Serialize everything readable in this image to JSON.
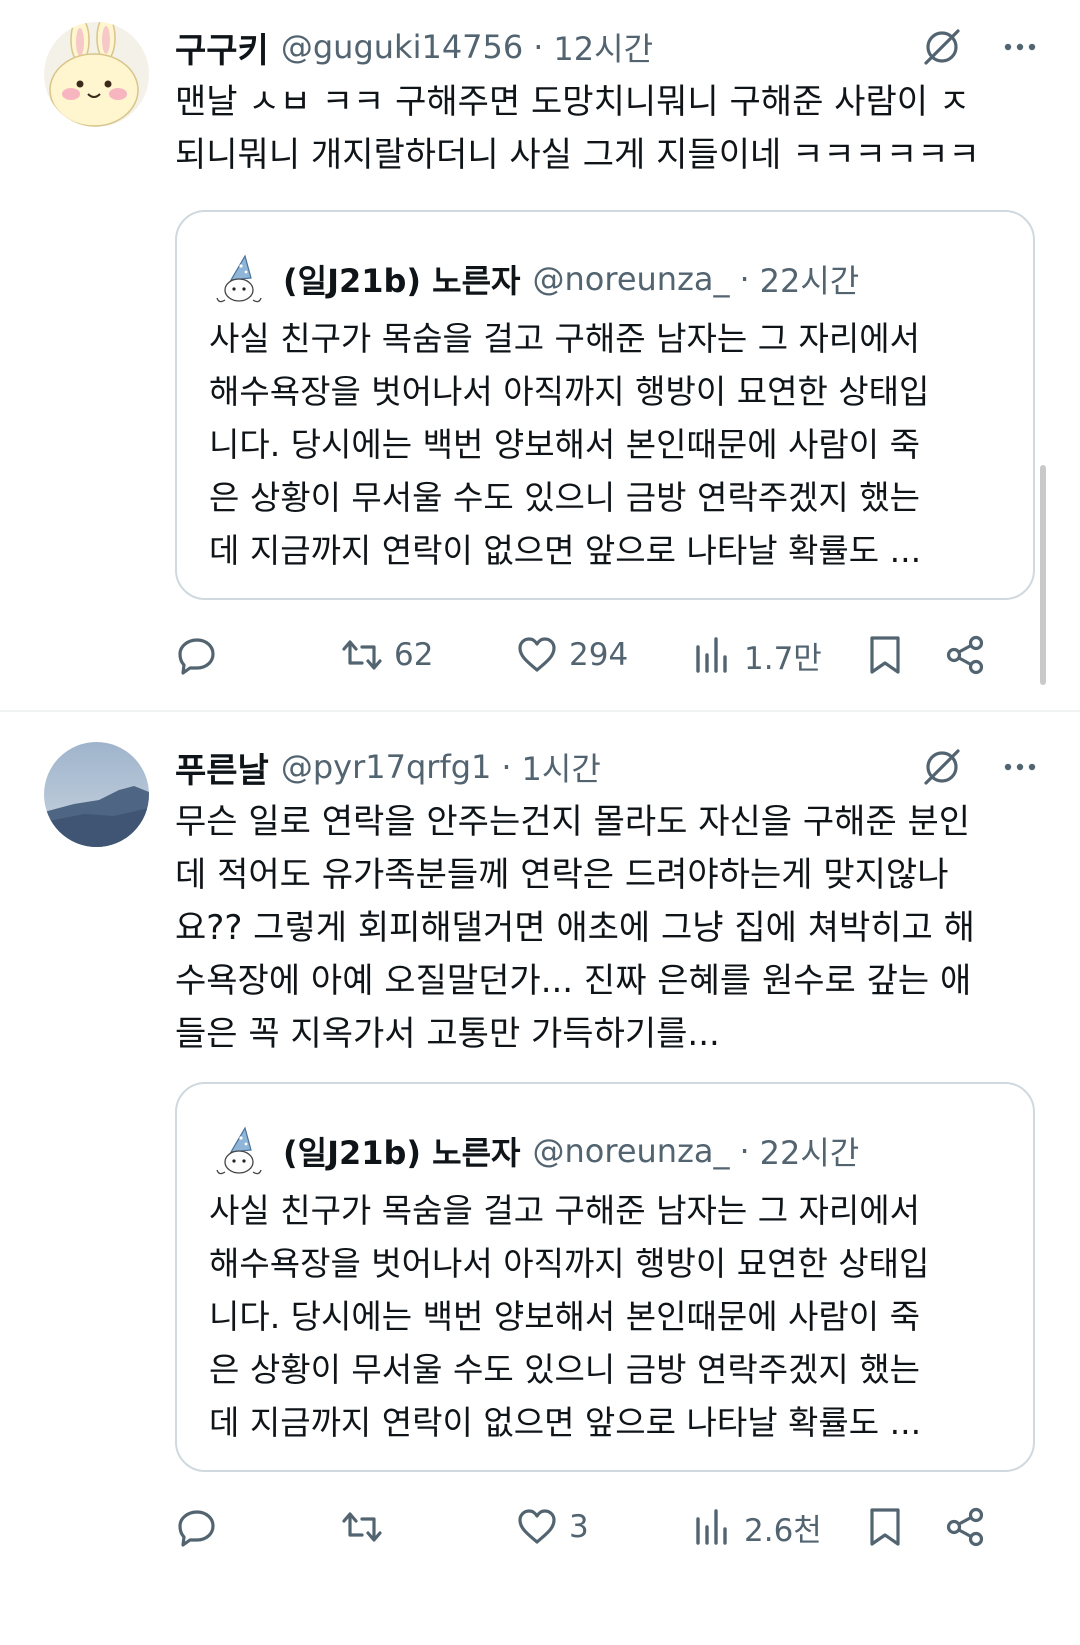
{
  "colors": {
    "text": "#0f1419",
    "muted": "#536471",
    "border": "#cfd9de"
  },
  "tweets": [
    {
      "name": "구구키",
      "handle": "@guguki14756",
      "separator": "·",
      "time": "12시간",
      "text": "맨날 ㅅㅂ ㅋㅋ 구해주면 도망치니뭐니 구해준 사람이 ㅈ\n되니뭐니 개지랄하더니 사실 그게 지들이네 ㅋㅋㅋㅋㅋㅋ",
      "quote": {
        "name": "(일J21b) 노른자",
        "handle": "@noreunza_",
        "separator": "·",
        "time": "22시간",
        "text": "사실 친구가 목숨을 걸고 구해준 남자는 그 자리에서\n해수욕장을 벗어나서 아직까지 행방이 묘연한 상태입\n니다. 당시에는 백번 양보해서 본인때문에 사람이 죽\n은 상황이 무서울 수도 있으니 금방 연락주겠지 했는\n데 지금까지 연락이 없으면 앞으로 나타날 확률도 ..."
      },
      "stats": {
        "replies": "",
        "retweets": "62",
        "likes": "294",
        "views": "1.7만"
      }
    },
    {
      "name": "푸른날",
      "handle": "@pyr17qrfg1",
      "separator": "·",
      "time": "1시간",
      "text": "무슨 일로 연락을 안주는건지 몰라도 자신을 구해준 분인\n데 적어도 유가족분들께 연락은 드려야하는게 맞지않나\n요?? 그렇게 회피해댈거면 애초에 그냥 집에 쳐박히고 해\n수욕장에 아예 오질말던가... 진짜 은혜를 원수로 갚는 애\n들은 꼭 지옥가서 고통만 가득하기를...",
      "quote": {
        "name": "(일J21b) 노른자",
        "handle": "@noreunza_",
        "separator": "·",
        "time": "22시간",
        "text": "사실 친구가 목숨을 걸고 구해준 남자는 그 자리에서\n해수욕장을 벗어나서 아직까지 행방이 묘연한 상태입\n니다. 당시에는 백번 양보해서 본인때문에 사람이 죽\n은 상황이 무서울 수도 있으니 금방 연락주겠지 했는\n데 지금까지 연락이 없으면 앞으로 나타날 확률도 ..."
      },
      "stats": {
        "replies": "",
        "retweets": "",
        "likes": "3",
        "views": "2.6천"
      }
    }
  ]
}
